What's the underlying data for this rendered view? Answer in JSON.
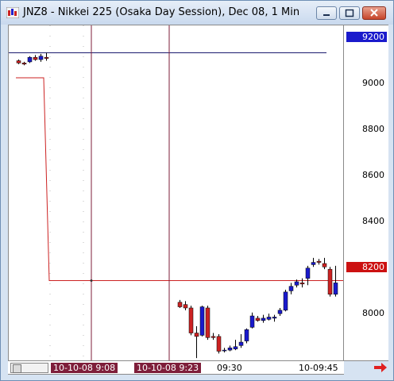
{
  "window": {
    "title": "JNZ8 - Nikkei 225 (Osaka Day Session), Dec 08, 1 Min"
  },
  "colors": {
    "up_candle": "#1a1acc",
    "down_candle": "#cc2222",
    "price_line": "#cc2222",
    "crosshair": "#7e1e3a",
    "hline": "#1a1a6e"
  },
  "yaxis": {
    "ticks": [
      "9200",
      "9000",
      "8800",
      "8600",
      "8400",
      "8200",
      "8000"
    ],
    "tag_9200": "9200",
    "tag_8200": "8200"
  },
  "xaxis": {
    "tag1": "10-10-08    9:08",
    "tag2": "10-10-08    9:23",
    "tick_930": "09:30",
    "tick_945": "10-09:45"
  },
  "chart_data": {
    "type": "candlestick",
    "ylim": [
      7850,
      9320
    ],
    "reference_levels": [
      9200,
      8200
    ],
    "step_line": [
      {
        "x": 0,
        "y": 9090
      },
      {
        "x": 5,
        "y": 9090
      },
      {
        "x": 6,
        "y": 8200
      },
      {
        "x": 54,
        "y": 8200
      }
    ],
    "candles_pre": [
      {
        "i": 0,
        "o": 9165,
        "c": 9155,
        "h": 9170,
        "l": 9150
      },
      {
        "i": 1,
        "o": 9155,
        "c": 9150,
        "h": 9160,
        "l": 9145
      },
      {
        "i": 2,
        "o": 9160,
        "c": 9180,
        "h": 9185,
        "l": 9155
      },
      {
        "i": 3,
        "o": 9180,
        "c": 9170,
        "h": 9190,
        "l": 9165
      },
      {
        "i": 4,
        "o": 9170,
        "c": 9185,
        "h": 9195,
        "l": 9160
      },
      {
        "i": 5,
        "o": 9180,
        "c": 9175,
        "h": 9200,
        "l": 9165
      }
    ],
    "candles": [
      {
        "i": 29,
        "o": 8105,
        "c": 8085,
        "h": 8115,
        "l": 8080
      },
      {
        "i": 30,
        "o": 8095,
        "c": 8080,
        "h": 8110,
        "l": 8070
      },
      {
        "i": 31,
        "o": 8080,
        "c": 7970,
        "h": 8090,
        "l": 7960
      },
      {
        "i": 32,
        "o": 7970,
        "c": 7955,
        "h": 8000,
        "l": 7860
      },
      {
        "i": 33,
        "o": 7960,
        "c": 8085,
        "h": 8090,
        "l": 7955
      },
      {
        "i": 34,
        "o": 8080,
        "c": 7950,
        "h": 8090,
        "l": 7940
      },
      {
        "i": 35,
        "o": 7955,
        "c": 7950,
        "h": 7970,
        "l": 7940
      },
      {
        "i": 36,
        "o": 7955,
        "c": 7890,
        "h": 7965,
        "l": 7880
      },
      {
        "i": 37,
        "o": 7895,
        "c": 7895,
        "h": 7905,
        "l": 7885
      },
      {
        "i": 38,
        "o": 7895,
        "c": 7905,
        "h": 7915,
        "l": 7890
      },
      {
        "i": 39,
        "o": 7900,
        "c": 7910,
        "h": 7940,
        "l": 7895
      },
      {
        "i": 40,
        "o": 7915,
        "c": 7930,
        "h": 7965,
        "l": 7905
      },
      {
        "i": 41,
        "o": 7935,
        "c": 7985,
        "h": 7990,
        "l": 7925
      },
      {
        "i": 42,
        "o": 7995,
        "c": 8045,
        "h": 8060,
        "l": 7990
      },
      {
        "i": 43,
        "o": 8035,
        "c": 8025,
        "h": 8045,
        "l": 8020
      },
      {
        "i": 44,
        "o": 8025,
        "c": 8035,
        "h": 8050,
        "l": 8015
      },
      {
        "i": 45,
        "o": 8030,
        "c": 8040,
        "h": 8055,
        "l": 8025
      },
      {
        "i": 46,
        "o": 8035,
        "c": 8040,
        "h": 8050,
        "l": 8020
      },
      {
        "i": 47,
        "o": 8055,
        "c": 8070,
        "h": 8080,
        "l": 8045
      },
      {
        "i": 48,
        "o": 8070,
        "c": 8150,
        "h": 8160,
        "l": 8065
      },
      {
        "i": 49,
        "o": 8155,
        "c": 8175,
        "h": 8190,
        "l": 8140
      },
      {
        "i": 50,
        "o": 8180,
        "c": 8195,
        "h": 8205,
        "l": 8170
      },
      {
        "i": 51,
        "o": 8190,
        "c": 8185,
        "h": 8210,
        "l": 8170
      },
      {
        "i": 52,
        "o": 8210,
        "c": 8255,
        "h": 8265,
        "l": 8180
      },
      {
        "i": 53,
        "o": 8270,
        "c": 8280,
        "h": 8300,
        "l": 8260
      },
      {
        "i": 54,
        "o": 8285,
        "c": 8280,
        "h": 8295,
        "l": 8270
      },
      {
        "i": 55,
        "o": 8275,
        "c": 8260,
        "h": 8300,
        "l": 8250
      },
      {
        "i": 56,
        "o": 8250,
        "c": 8140,
        "h": 8260,
        "l": 8130
      },
      {
        "i": 57,
        "o": 8140,
        "c": 8190,
        "h": 8265,
        "l": 8130
      }
    ],
    "crosshair_indices": [
      13,
      27
    ]
  }
}
